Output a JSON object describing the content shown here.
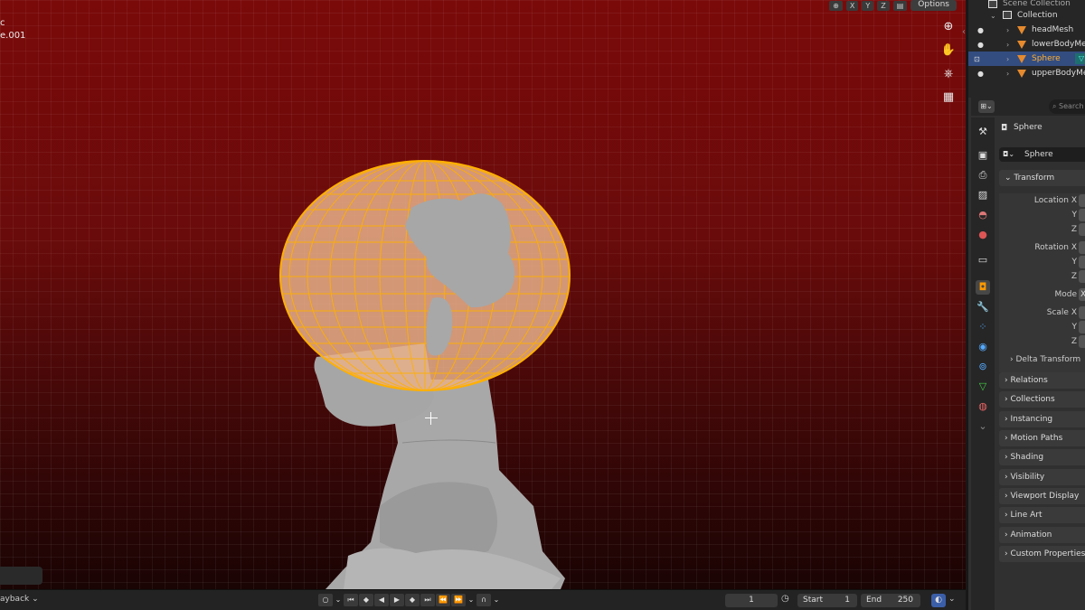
{
  "viewport": {
    "overlay_line1": "c",
    "overlay_line2": "e.001",
    "header_buttons": [
      "X",
      "Y",
      "Z"
    ],
    "options_label": "Options",
    "tools": [
      "zoom-icon",
      "hand-icon",
      "camera-icon",
      "grid-icon"
    ],
    "background_top": "#7a0a0a",
    "selection_color": "#ffb000"
  },
  "outliner": {
    "scene_collection": "Scene Collection",
    "collection": "Collection",
    "items": [
      {
        "label": "headMesh",
        "selected": false
      },
      {
        "label": "lowerBodyMes",
        "selected": false
      },
      {
        "label": "Sphere",
        "selected": true
      },
      {
        "label": "upperBodyMes",
        "selected": false
      }
    ]
  },
  "properties": {
    "search_placeholder": "Search",
    "object_title": "Sphere",
    "object_name": "Sphere",
    "transform": {
      "header": "Transform",
      "location_x": "Location X",
      "location_y": "Y",
      "location_z": "Z",
      "rotation_x": "Rotation X",
      "rotation_y": "Y",
      "rotation_z": "Z",
      "mode": "Mode",
      "mode_value": "X",
      "scale_x": "Scale X",
      "scale_y": "Y",
      "scale_z": "Z",
      "delta": "Delta Transform"
    },
    "panels": [
      "Relations",
      "Collections",
      "Instancing",
      "Motion Paths",
      "Shading",
      "Visibility",
      "Viewport Display",
      "Line Art",
      "Animation",
      "Custom Properties"
    ]
  },
  "timeline": {
    "playback": "ayback",
    "current_frame": "1",
    "start_label": "Start",
    "start_value": "1",
    "end_label": "End",
    "end_value": "250"
  }
}
